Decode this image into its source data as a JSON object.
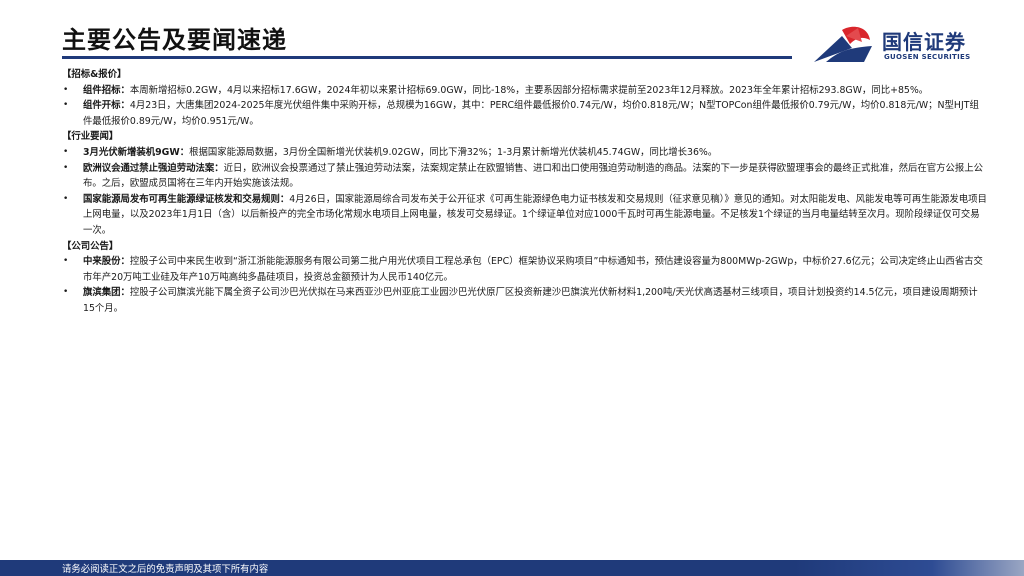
{
  "title": "主要公告及要闻速递",
  "logo": {
    "name_cn": "国信证券",
    "name_en": "GUOSEN SECURITIES",
    "icon": "guosen-logo-icon",
    "colors": {
      "red": "#d9262c",
      "blue": "#1f3a7a"
    }
  },
  "sections": [
    {
      "heading": "【招标&报价】",
      "items": [
        {
          "title": "组件招标：",
          "text": "本周新增招标0.2GW，4月以来招标17.6GW，2024年初以来累计招标69.0GW，同比-18%，主要系因部分招标需求提前至2023年12月释放。2023年全年累计招标293.8GW，同比+85%。"
        },
        {
          "title": "组件开标：",
          "text": "4月23日，大唐集团2024-2025年度光伏组件集中采购开标，总规模为16GW，其中：PERC组件最低报价0.74元/W，均价0.818元/W；N型TOPCon组件最低报价0.79元/W，均价0.818元/W；N型HJT组件最低报价0.89元/W，均价0.951元/W。"
        }
      ]
    },
    {
      "heading": "【行业要闻】",
      "items": [
        {
          "title": "3月光伏新增装机9GW：",
          "text": "根据国家能源局数据，3月份全国新增光伏装机9.02GW，同比下滑32%；1-3月累计新增光伏装机45.74GW，同比增长36%。"
        },
        {
          "title": "欧洲议会通过禁止强迫劳动法案：",
          "text": "近日，欧洲议会投票通过了禁止强迫劳动法案，法案规定禁止在欧盟销售、进口和出口使用强迫劳动制造的商品。法案的下一步是获得欧盟理事会的最终正式批准，然后在官方公报上公布。之后，欧盟成员国将在三年内开始实施该法规。"
        },
        {
          "title": "国家能源局发布可再生能源绿证核发和交易规则：",
          "text": "4月26日，国家能源局综合司发布关于公开征求《可再生能源绿色电力证书核发和交易规则（征求意见稿）》意见的通知。对太阳能发电、风能发电等可再生能源发电项目上网电量，以及2023年1月1日（含）以后新投产的完全市场化常规水电项目上网电量，核发可交易绿证。1个绿证单位对应1000千瓦时可再生能源电量。不足核发1个绿证的当月电量结转至次月。现阶段绿证仅可交易一次。"
        }
      ]
    },
    {
      "heading": "【公司公告】",
      "items": [
        {
          "title": "中来股份：",
          "text": "控股子公司中来民生收到“浙江浙能能源服务有限公司第二批户用光伏项目工程总承包（EPC）框架协议采购项目”中标通知书，预估建设容量为800MWp-2GWp，中标价27.6亿元；公司决定终止山西省古交市年产20万吨工业硅及年产10万吨高纯多晶硅项目，投资总金额预计为人民币140亿元。"
        },
        {
          "title": "旗滨集团：",
          "text": "控股子公司旗滨光能下属全资子公司沙巴光伏拟在马来西亚沙巴州亚庇工业园沙巴光伏原厂区投资新建沙巴旗滨光伏新材料1,200吨/天光伏高透基材三线项目，项目计划投资约14.5亿元，项目建设周期预计15个月。"
        }
      ]
    }
  ],
  "footer": {
    "disclaimer": "请务必阅读正文之后的免责声明及其项下所有内容"
  }
}
